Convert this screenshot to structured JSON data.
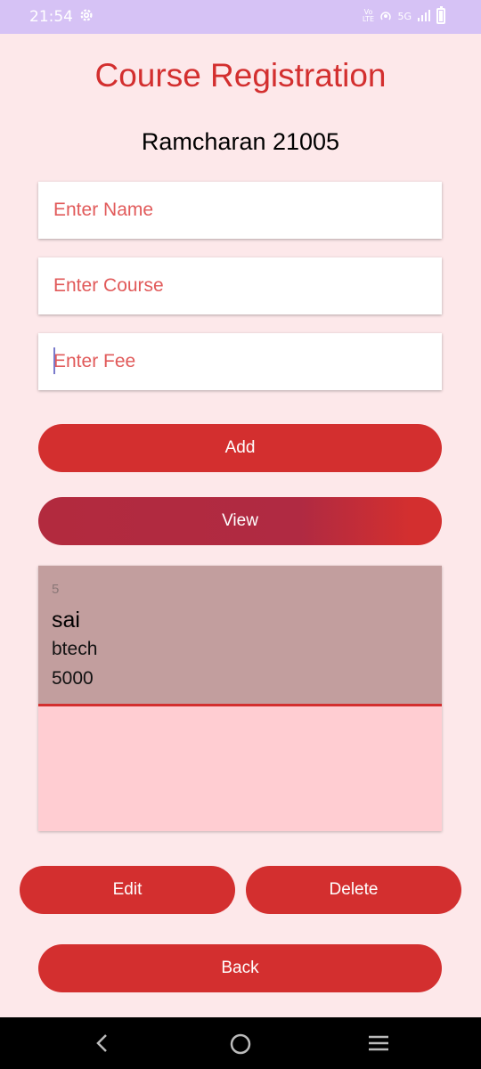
{
  "status": {
    "time": "21:54",
    "network": "5G",
    "volte": "Vo LTE"
  },
  "header": {
    "title": "Course Registration",
    "subtitle": "Ramcharan 21005"
  },
  "form": {
    "name_placeholder": "Enter Name",
    "course_placeholder": "Enter Course",
    "fee_placeholder": "Enter Fee"
  },
  "buttons": {
    "add": "Add",
    "view": "View",
    "edit": "Edit",
    "delete": "Delete",
    "back": "Back"
  },
  "records": [
    {
      "id": "5",
      "name": "sai",
      "course": "btech",
      "fee": "5000"
    }
  ],
  "colors": {
    "accent": "#d32f2f",
    "background": "#fde8ea",
    "list_bg": "#ffcdd2",
    "row_bg": "#c29e9e",
    "status_bar": "#d6c2f5"
  },
  "navigation": {
    "icons": [
      "back-icon",
      "home-icon",
      "recents-icon"
    ]
  }
}
